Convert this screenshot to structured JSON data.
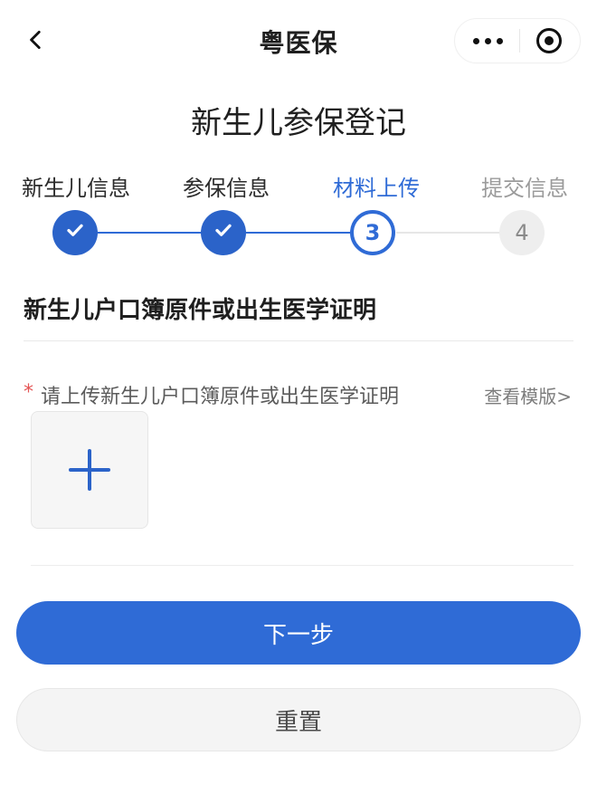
{
  "topbar": {
    "title": "粤医保",
    "back_icon": "chevron-left-icon",
    "more_icon": "more-dots-icon",
    "target_icon": "target-icon"
  },
  "page": {
    "title": "新生儿参保登记"
  },
  "steps": [
    {
      "label": "新生儿信息",
      "state": "done"
    },
    {
      "label": "参保信息",
      "state": "done"
    },
    {
      "label": "材料上传",
      "state": "active",
      "number": "3"
    },
    {
      "label": "提交信息",
      "state": "todo",
      "number": "4"
    }
  ],
  "section": {
    "title": "新生儿户口簿原件或出生医学证明"
  },
  "upload": {
    "required_mark": "*",
    "label": "请上传新生儿户口簿原件或出生医学证明",
    "template_link": "查看模版>"
  },
  "actions": {
    "next": "下一步",
    "reset": "重置"
  },
  "colors": {
    "primary": "#2f6bd6",
    "muted": "#9b9b9b",
    "required": "#e45454"
  }
}
